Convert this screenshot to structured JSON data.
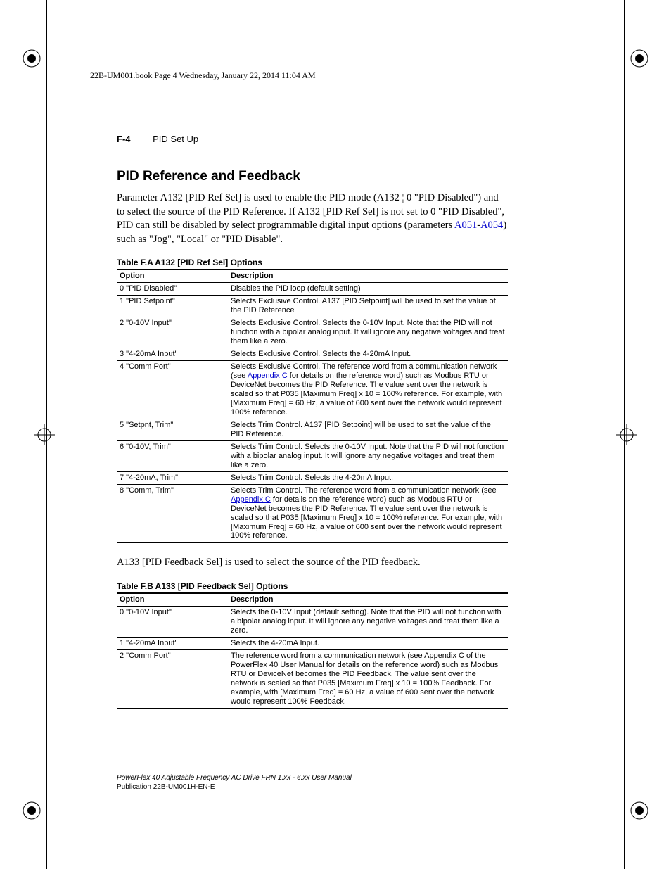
{
  "header": {
    "book_line": "22B-UM001.book  Page 4  Wednesday, January 22, 2014  11:04 AM"
  },
  "running_head": {
    "page_num": "F-4",
    "chapter": "PID Set Up"
  },
  "section": {
    "title": "PID Reference and Feedback",
    "para1_a": "Parameter A132 [PID Ref Sel] is used to enable the PID mode (A132 ¦ 0 \"PID Disabled\") and to select the source of the PID Reference. If A132 [PID Ref Sel] is not set to 0 \"PID Disabled\", PID can still be disabled by select programmable digital input options (parameters ",
    "link1": "A051",
    "dash": "-",
    "link2": "A054",
    "para1_b": ") such as \"Jog\", \"Local\" or \"PID Disable\".",
    "para2": "A133 [PID Feedback Sel] is used to select the source of the PID feedback."
  },
  "tableA": {
    "caption": "Table F.A   A132 [PID Ref Sel] Options",
    "head_option": "Option",
    "head_desc": "Description",
    "rows": [
      {
        "opt": "0 \"PID Disabled\"",
        "desc_a": "Disables the PID loop (default setting)"
      },
      {
        "opt": "1 \"PID Setpoint\"",
        "desc_a": "Selects Exclusive Control. A137 [PID Setpoint] will be used to set the value of the PID Reference"
      },
      {
        "opt": "2 \"0-10V Input\"",
        "desc_a": "Selects Exclusive Control. Selects the 0-10V Input. Note that the PID will not function with a bipolar analog input. It will ignore any negative voltages and treat them like a zero."
      },
      {
        "opt": "3 \"4-20mA Input\"",
        "desc_a": "Selects Exclusive Control. Selects the 4-20mA Input."
      },
      {
        "opt": "4 \"Comm Port\"",
        "desc_a": "Selects Exclusive Control. The reference word from a communication network (see ",
        "link": "Appendix C",
        "desc_b": " for details on the reference word) such as Modbus RTU or DeviceNet becomes the PID Reference. The value sent over the network is scaled so that P035 [Maximum Freq] x 10 = 100% reference. For example, with [Maximum Freq] = 60 Hz, a value of 600 sent over the network would represent 100% reference."
      },
      {
        "opt": "5 \"Setpnt, Trim\"",
        "desc_a": "Selects Trim Control. A137 [PID Setpoint] will be used to set the value of the PID Reference."
      },
      {
        "opt": "6 \"0-10V, Trim\"",
        "desc_a": "Selects Trim Control. Selects the 0-10V Input. Note that the PID will not function with a bipolar analog input. It will ignore any negative voltages and treat them like a zero."
      },
      {
        "opt": "7 \"4-20mA, Trim\"",
        "desc_a": "Selects Trim Control. Selects the 4-20mA Input."
      },
      {
        "opt": "8 \"Comm, Trim\"",
        "desc_a": "Selects Trim Control. The reference word from a communication network (see ",
        "link": "Appendix C",
        "desc_b": " for details on the reference word) such as Modbus RTU or DeviceNet becomes the PID Reference. The value sent over the network is scaled so that P035 [Maximum Freq] x 10 = 100% reference. For example, with [Maximum Freq] = 60 Hz, a value of 600 sent over the network would represent 100% reference."
      }
    ]
  },
  "tableB": {
    "caption": "Table F.B   A133 [PID Feedback Sel] Options",
    "head_option": "Option",
    "head_desc": "Description",
    "rows": [
      {
        "opt": "0 \"0-10V Input\"",
        "desc_a": "Selects the 0-10V Input (default setting). Note that the PID will not function with a bipolar analog input. It will ignore any negative voltages and treat them like a zero."
      },
      {
        "opt": "1 \"4-20mA Input\"",
        "desc_a": "Selects the 4-20mA Input."
      },
      {
        "opt": "2 \"Comm Port\"",
        "desc_a": "The reference word from a communication network (see Appendix C of the PowerFlex 40 User Manual for details on the reference word) such as Modbus RTU or DeviceNet becomes the PID Feedback. The value sent over the network is scaled so that P035 [Maximum Freq] x 10 = 100% Feedback. For example, with [Maximum Freq] = 60 Hz, a value of 600 sent over the network would represent 100% Feedback."
      }
    ]
  },
  "footer": {
    "line1": "PowerFlex 40 Adjustable Frequency AC Drive FRN 1.xx - 6.xx User Manual",
    "line2": "Publication 22B-UM001H-EN-E"
  }
}
